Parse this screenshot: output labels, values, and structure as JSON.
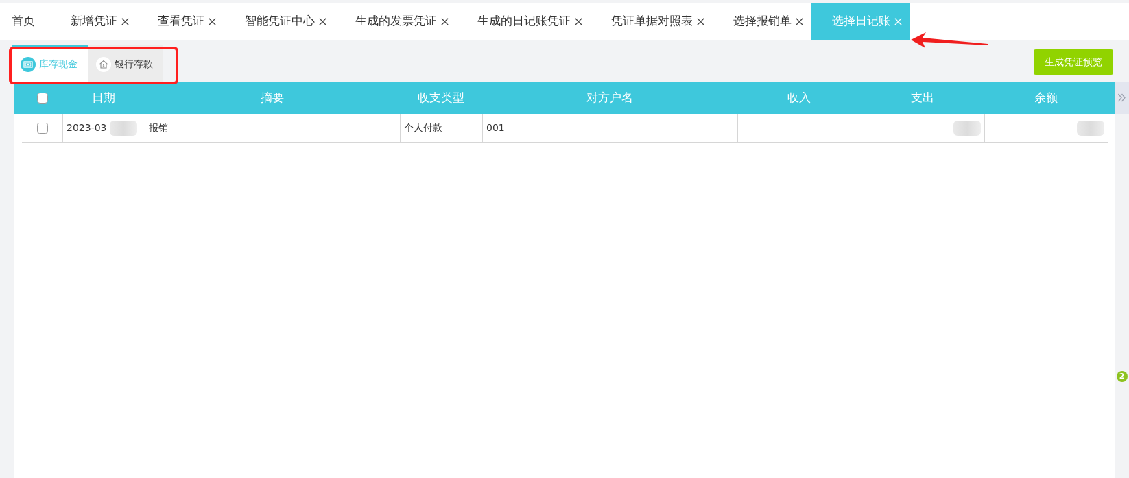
{
  "tabs": [
    {
      "label": "首页",
      "selected": false,
      "closable": false
    },
    {
      "label": "新增凭证",
      "selected": false,
      "closable": true
    },
    {
      "label": "查看凭证",
      "selected": false,
      "closable": true
    },
    {
      "label": "智能凭证中心",
      "selected": false,
      "closable": true
    },
    {
      "label": "生成的发票凭证",
      "selected": false,
      "closable": true
    },
    {
      "label": "生成的日记账凭证",
      "selected": false,
      "closable": true
    },
    {
      "label": "凭证单据对照表",
      "selected": false,
      "closable": true
    },
    {
      "label": "选择报销单",
      "selected": false,
      "closable": true
    },
    {
      "label": "选择日记账",
      "selected": true,
      "closable": true
    }
  ],
  "subtabs": [
    {
      "label": "库存现金",
      "kind": "cash",
      "selected": true
    },
    {
      "label": "银行存款",
      "kind": "bank",
      "selected": false
    }
  ],
  "preview_button": "生成凭证预览",
  "table": {
    "select_all_checked": false,
    "columns": [
      {
        "label": "日期",
        "kind": "text"
      },
      {
        "label": "摘要",
        "kind": "text"
      },
      {
        "label": "收支类型",
        "kind": "text"
      },
      {
        "label": "对方户名",
        "kind": "text"
      },
      {
        "label": "收入",
        "kind": "money"
      },
      {
        "label": "支出",
        "kind": "money"
      },
      {
        "label": "余额",
        "kind": "money"
      }
    ],
    "rows": [
      {
        "checked": false,
        "cells": [
          {
            "text": "2023-03",
            "redacted": true
          },
          {
            "text": "报销",
            "redacted": false
          },
          {
            "text": "个人付款",
            "redacted": false
          },
          {
            "text": "001",
            "redacted": false
          },
          {
            "redacted": false
          },
          {
            "redacted": true
          },
          {
            "redacted": true
          }
        ]
      }
    ]
  },
  "side_badge": "2",
  "annotations": {
    "highlight_frame": true,
    "pointer_arrow": true
  }
}
